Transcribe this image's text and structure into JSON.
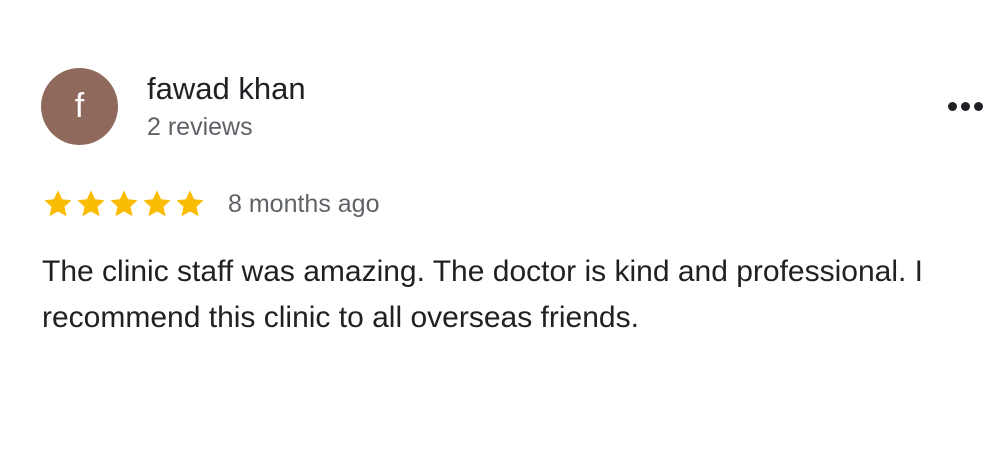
{
  "review": {
    "avatar_letter": "f",
    "avatar_color": "#8f6a5c",
    "reviewer_name": "fawad khan",
    "review_count": "2 reviews",
    "more_icon": "more-horizontal-icon",
    "rating": 5,
    "rating_max": 5,
    "star_color": "#fbbc04",
    "date": "8 months ago",
    "text": "The clinic staff was amazing. The doctor is kind and professional. I recommend this clinic to all overseas friends."
  }
}
